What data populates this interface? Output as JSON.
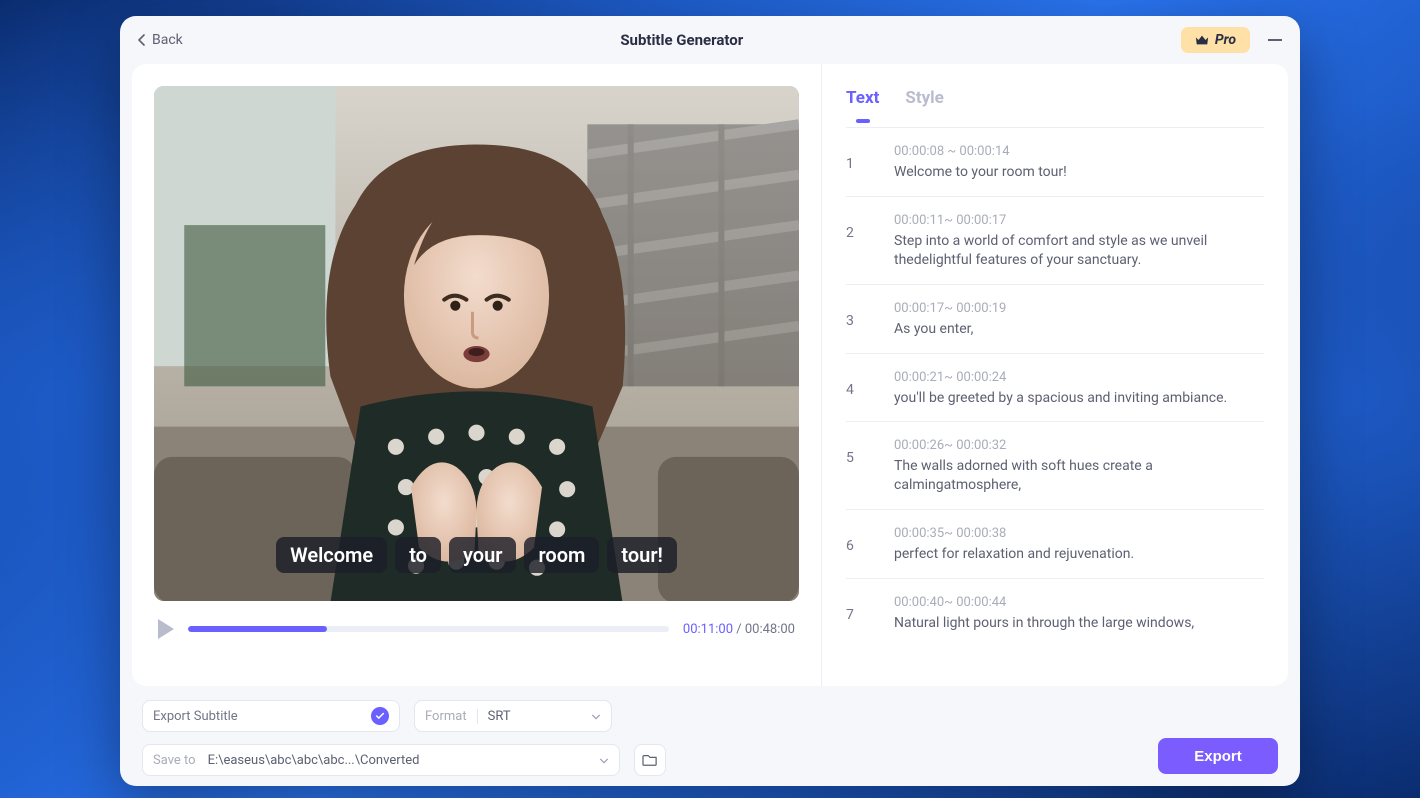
{
  "header": {
    "back_label": "Back",
    "title": "Subtitle Generator",
    "pro_label": "Pro"
  },
  "tabs": {
    "text": "Text",
    "style": "Style",
    "active": "text"
  },
  "player": {
    "current_time": "00:11:00",
    "total_time": "00:48:00",
    "time_sep": " / "
  },
  "overlay_words": [
    "Welcome",
    "to",
    "your",
    "room",
    "tour!"
  ],
  "subtitles": [
    {
      "idx": "1",
      "time": "00:00:08 ~ 00:00:14",
      "text": "Welcome to your room tour!"
    },
    {
      "idx": "2",
      "time": "00:00:11~ 00:00:17",
      "text": "Step into a world of comfort and style as we unveil thedelightful features of your sanctuary."
    },
    {
      "idx": "3",
      "time": "00:00:17~ 00:00:19",
      "text": "As you enter,"
    },
    {
      "idx": "4",
      "time": "00:00:21~ 00:00:24",
      "text": "you'll be greeted by a spacious and inviting ambiance."
    },
    {
      "idx": "5",
      "time": "00:00:26~ 00:00:32",
      "text": "The walls adorned with soft hues create a calmingatmosphere,"
    },
    {
      "idx": "6",
      "time": "00:00:35~ 00:00:38",
      "text": "perfect for relaxation and rejuvenation."
    },
    {
      "idx": "7",
      "time": "00:00:40~ 00:00:44",
      "text": "Natural light pours in through the large windows,"
    }
  ],
  "bottom": {
    "export_type_label": "Export Subtitle",
    "format_label": "Format",
    "format_value": "SRT",
    "saveto_label": "Save to",
    "saveto_value": "E:\\easeus\\abc\\abc\\abc...\\Converted",
    "export_button": "Export"
  }
}
